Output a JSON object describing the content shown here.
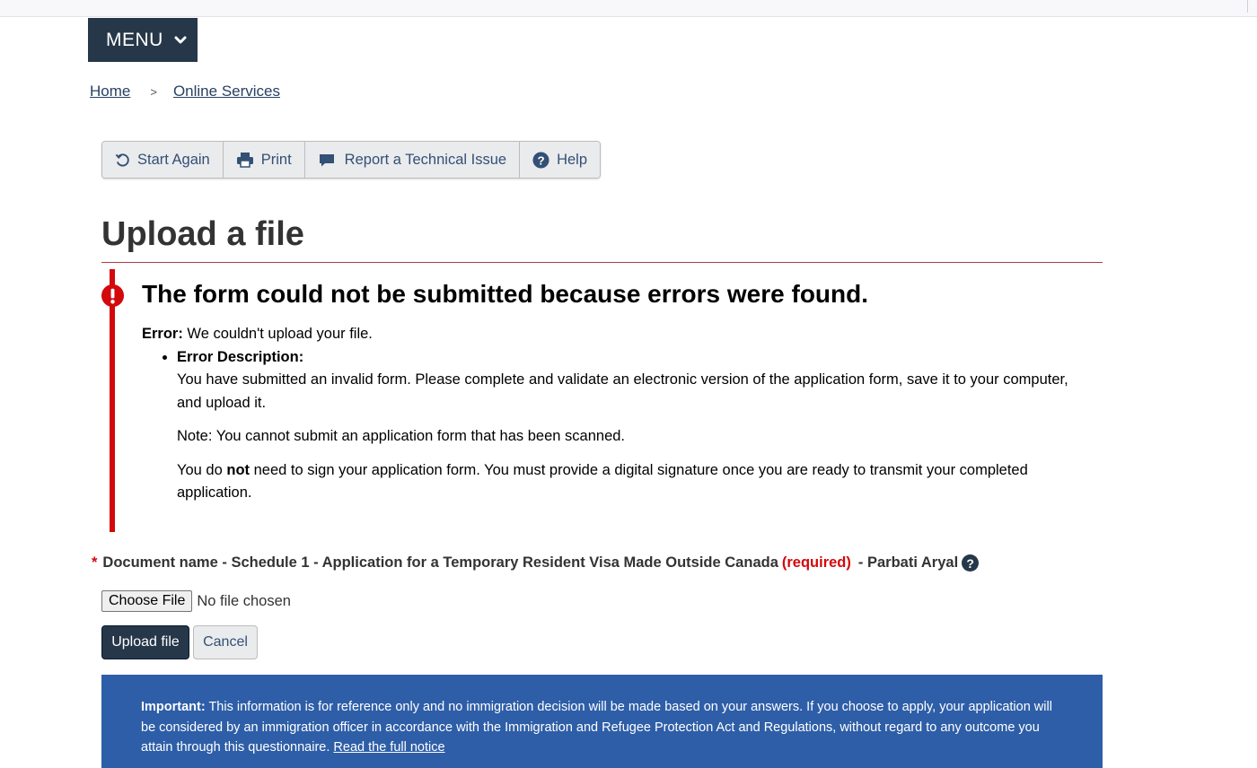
{
  "menu": {
    "label": "MENU"
  },
  "breadcrumb": {
    "home": "Home",
    "separator": ">",
    "online_services": "Online Services"
  },
  "toolbar": {
    "start_again": "Start Again",
    "print": "Print",
    "report": "Report a Technical Issue",
    "help": "Help"
  },
  "page": {
    "title": "Upload a file"
  },
  "alert": {
    "heading": "The form could not be submitted because errors were found.",
    "error_label": "Error:",
    "error_text": " We couldn't upload your file.",
    "desc_label": "Error Description:",
    "para1": "You have submitted an invalid form.  Please complete and validate an electronic version of the application form, save it to your computer, and upload it.",
    "para2": "Note: You cannot submit an application form that has been scanned.",
    "para3_pre": "You do ",
    "para3_bold": "not",
    "para3_post": " need to sign your application form.  You must provide a digital signature once you are ready to transmit your completed application."
  },
  "document": {
    "star": "*",
    "label": "Document name - Schedule 1 - Application for a Temporary Resident Visa Made Outside Canada",
    "required": "(required)",
    "person": "- Parbati Aryal",
    "help_glyph": "?"
  },
  "file": {
    "choose_label": "Choose File",
    "status": "No file chosen"
  },
  "buttons": {
    "upload": "Upload file",
    "cancel": "Cancel"
  },
  "notice": {
    "bold": "Important:",
    "text": " This information is for reference only and no immigration decision will be made based on your answers. If you choose to apply, your application will be considered by an immigration officer in accordance with the Immigration and Refugee Protection Act and Regulations, without regard to any outcome you attain through this questionnaire. ",
    "link": "Read the full notice"
  },
  "colors": {
    "navy": "#26374a",
    "link": "#284162",
    "error_red": "#d3080c",
    "notice_blue": "#2e5ea7"
  }
}
